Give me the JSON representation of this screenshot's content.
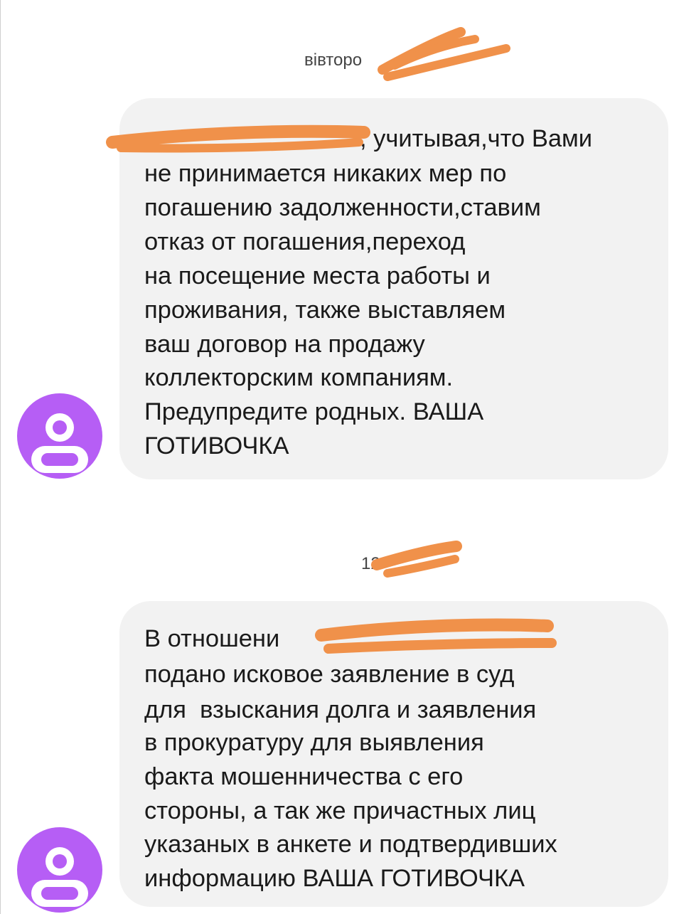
{
  "colors": {
    "bubble_background": "#f2f2f2",
    "avatar_background": "#b65ef5",
    "redaction": "#f0914a",
    "text": "#1a1a1a",
    "date_text": "#444444"
  },
  "messages": [
    {
      "date_label": "вівторо",
      "avatar_icon": "person-icon",
      "lines": [
        ", учитывая,что Вами",
        "не принимается никаких мер по",
        "погашению задолженности,ставим",
        "отказ от погашения,переход",
        "на посещение места работы и",
        "проживания, также выставляем",
        "ваш договор на продажу",
        "коллекторским компаниям.",
        "Предупредите родных. ВАША",
        "ГОТИВОЧКА"
      ]
    },
    {
      "date_label": "12",
      "avatar_icon": "person-icon",
      "lines": [
        "В отношени",
        "подано исковое заявление в суд",
        "для  взыскания долга и заявления",
        "в прокуратуру для выявления",
        "факта мошенничества с его",
        "стороны, а так же причастных лиц",
        "указаных в анкете и подтвердивших",
        "информацию ВАША ГОТИВОЧКА"
      ]
    }
  ]
}
